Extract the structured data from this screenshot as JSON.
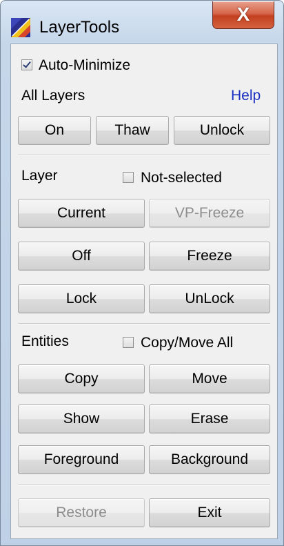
{
  "window": {
    "title": "LayerTools",
    "close_label": "X"
  },
  "options": {
    "auto_minimize_label": "Auto-Minimize",
    "auto_minimize_checked": true
  },
  "all_layers": {
    "heading": "All Layers",
    "help_label": "Help",
    "on_label": "On",
    "thaw_label": "Thaw",
    "unlock_label": "Unlock"
  },
  "layer": {
    "heading": "Layer",
    "not_selected_label": "Not-selected",
    "not_selected_checked": false,
    "current_label": "Current",
    "vp_freeze_label": "VP-Freeze",
    "off_label": "Off",
    "freeze_label": "Freeze",
    "lock_label": "Lock",
    "unlock_label": "UnLock"
  },
  "entities": {
    "heading": "Entities",
    "copy_move_all_label": "Copy/Move All",
    "copy_move_all_checked": false,
    "copy_label": "Copy",
    "move_label": "Move",
    "show_label": "Show",
    "erase_label": "Erase",
    "foreground_label": "Foreground",
    "background_label": "Background"
  },
  "footer": {
    "restore_label": "Restore",
    "exit_label": "Exit"
  },
  "colors": {
    "link": "#1a2fbf",
    "disabled_text": "#8d8d8d",
    "close_button": "#c3401f"
  }
}
